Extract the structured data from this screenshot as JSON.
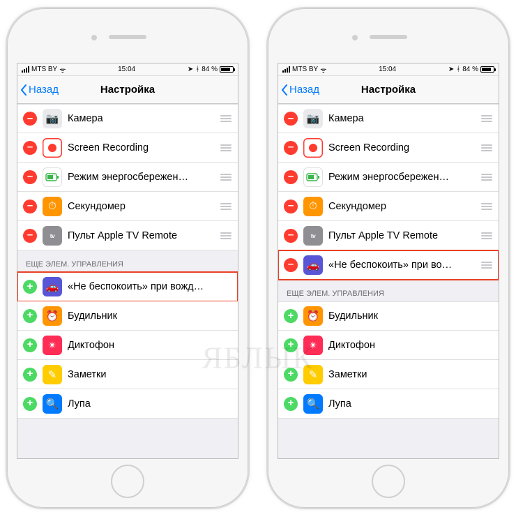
{
  "statusbar": {
    "carrier": "MTS BY",
    "wifi": "ᯤ",
    "time": "15:04",
    "battery_pct": "84 %",
    "icons": {
      "nav": "➤",
      "bt": "ᚼ"
    }
  },
  "nav": {
    "back": "Назад",
    "title": "Настройка"
  },
  "section_more": "ЕЩЕ ЭЛЕМ. УПРАВЛЕНИЯ",
  "left": {
    "included": [
      {
        "icon": "camera",
        "label": "Камера"
      },
      {
        "icon": "screc",
        "label": "Screen Recording"
      },
      {
        "icon": "battery",
        "label": "Режим энергосбережен…"
      },
      {
        "icon": "stopw",
        "label": "Секундомер"
      },
      {
        "icon": "atv",
        "label": "Пульт Apple TV Remote"
      }
    ],
    "more": [
      {
        "icon": "dnd",
        "label": "«Не беспокоить» при вожд…",
        "highlight": true
      },
      {
        "icon": "alarm",
        "label": "Будильник"
      },
      {
        "icon": "voice",
        "label": "Диктофон"
      },
      {
        "icon": "notes",
        "label": "Заметки"
      },
      {
        "icon": "mag",
        "label": "Лупа"
      }
    ]
  },
  "right": {
    "included": [
      {
        "icon": "camera",
        "label": "Камера"
      },
      {
        "icon": "screc",
        "label": "Screen Recording"
      },
      {
        "icon": "battery",
        "label": "Режим энергосбережен…"
      },
      {
        "icon": "stopw",
        "label": "Секундомер"
      },
      {
        "icon": "atv",
        "label": "Пульт Apple TV Remote"
      },
      {
        "icon": "dnd",
        "label": "«Не беспокоить» при во…",
        "highlight": true
      }
    ],
    "more": [
      {
        "icon": "alarm",
        "label": "Будильник"
      },
      {
        "icon": "voice",
        "label": "Диктофон"
      },
      {
        "icon": "notes",
        "label": "Заметки"
      },
      {
        "icon": "mag",
        "label": "Лупа"
      }
    ]
  },
  "watermark": "ЯБЛЫК",
  "icon_glyph": {
    "camera": "📷",
    "battery": "🔋",
    "stopw": "⏱",
    "atv": "📺tv",
    "dnd": "🚗",
    "alarm": "⏰",
    "voice": "✴",
    "notes": "✎",
    "mag": "🔍"
  }
}
